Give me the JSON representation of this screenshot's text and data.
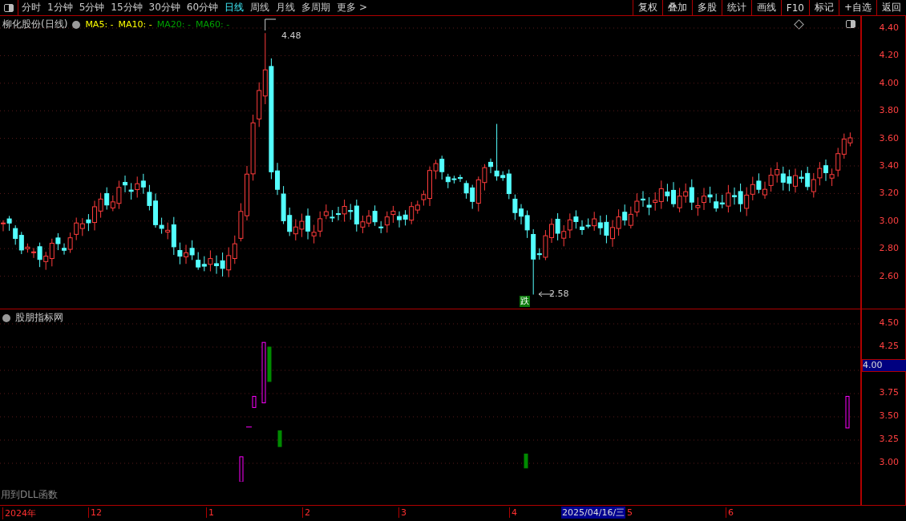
{
  "toolbar": {
    "period_tabs": [
      {
        "label": "分时",
        "selected": false
      },
      {
        "label": "1分钟",
        "selected": false
      },
      {
        "label": "5分钟",
        "selected": false
      },
      {
        "label": "15分钟",
        "selected": false
      },
      {
        "label": "30分钟",
        "selected": false
      },
      {
        "label": "60分钟",
        "selected": false
      },
      {
        "label": "日线",
        "selected": true
      },
      {
        "label": "周线",
        "selected": false
      },
      {
        "label": "月线",
        "selected": false
      },
      {
        "label": "多周期",
        "selected": false
      },
      {
        "label": "更多 >",
        "selected": false
      }
    ],
    "buttons": [
      "复权",
      "叠加",
      "多股",
      "统计",
      "画线",
      "F10",
      "标记",
      "+自选",
      "返回"
    ]
  },
  "chart": {
    "title": "柳化股份(日线)",
    "ma": [
      {
        "label": "MA5: -",
        "color": "#ffff00"
      },
      {
        "label": "MA10: -",
        "color": "#ffff00"
      },
      {
        "label": "MA20: -",
        "color": "#00a000"
      },
      {
        "label": "MA60: -",
        "color": "#00a000"
      }
    ],
    "high_label": "4.48",
    "low_label": "2.58",
    "signal": "跌",
    "price_ticks": [
      "4.40",
      "4.20",
      "4.00",
      "3.80",
      "3.60",
      "3.40",
      "3.20",
      "3.00",
      "2.80",
      "2.60"
    ]
  },
  "indicator": {
    "title": "股朋指标网",
    "ticks": [
      "4.50",
      "4.25",
      "3.75",
      "3.50",
      "3.25",
      "3.00"
    ],
    "current": "4.00",
    "note": "用到DLL函数"
  },
  "time_axis": {
    "labels": [
      "2024年",
      "12",
      "1",
      "2",
      "3",
      "4",
      "5",
      "6"
    ],
    "cursor_date": "2025/04/16/三"
  }
}
